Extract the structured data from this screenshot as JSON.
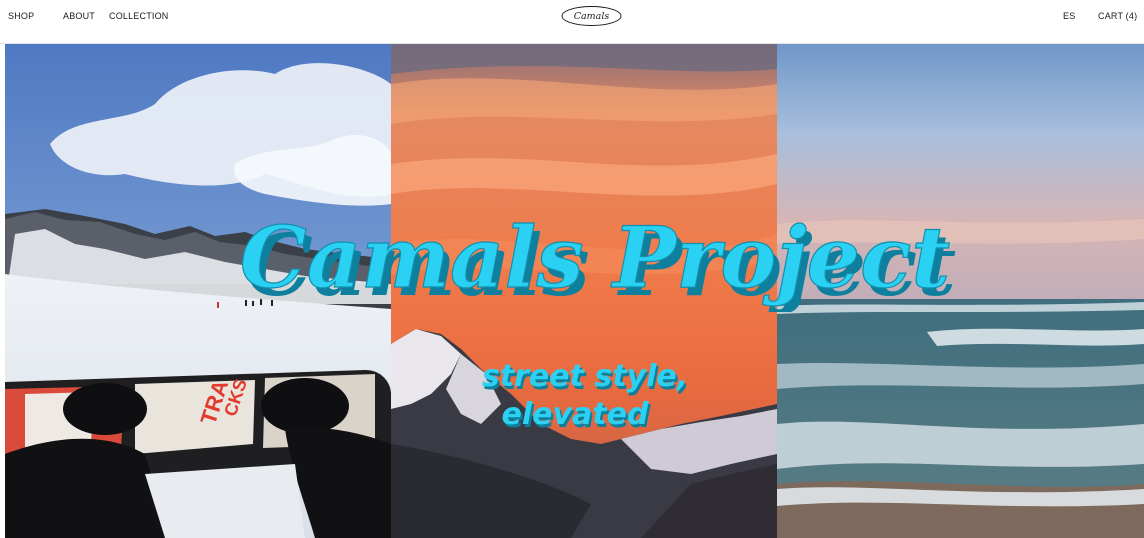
{
  "nav": {
    "left": [
      {
        "label": "SHOP"
      },
      {
        "label": "ABOUT"
      },
      {
        "label": "COLLECTION"
      }
    ],
    "logo_text": "Camals",
    "language": "ES",
    "cart_label": "CART (4)"
  },
  "hero": {
    "title": "Camals Project",
    "tagline_line1": "street style,",
    "tagline_line2": "elevated",
    "panels": [
      {
        "name": "snowboard-mountain-photo"
      },
      {
        "name": "sunset-mountain-photo"
      },
      {
        "name": "ocean-waves-photo"
      }
    ]
  },
  "colors": {
    "title_fill": "#2ad1f2",
    "title_shadow": "#0f7f9e",
    "header_text": "#1a1a1a"
  }
}
